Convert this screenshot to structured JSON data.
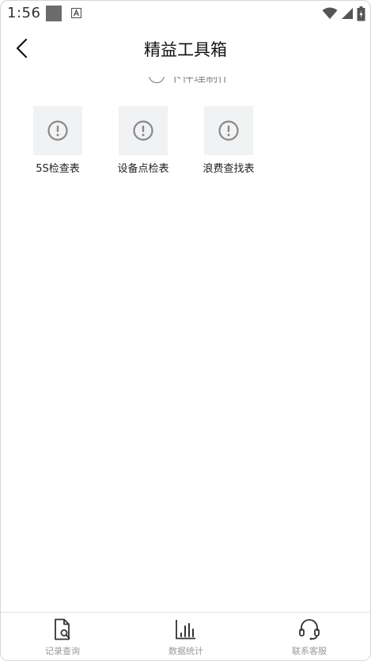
{
  "status_bar": {
    "time": "1:56",
    "icons": [
      "notification-square-icon",
      "a-icon",
      "wifi-icon",
      "signal-icon",
      "battery-icon"
    ]
  },
  "header": {
    "back_icon": "chevron-left-icon",
    "title": "精益工具箱"
  },
  "subtab_remnant": {
    "text": "卜件理制作",
    "icon": "circle-icon"
  },
  "tools": [
    {
      "label": "5S检查表",
      "icon": "alert-circle-icon"
    },
    {
      "label": "设备点检表",
      "icon": "alert-circle-icon"
    },
    {
      "label": "浪费查找表",
      "icon": "alert-circle-icon"
    }
  ],
  "tab_bar": {
    "items": [
      {
        "label": "记录查询",
        "icon": "document-search-icon"
      },
      {
        "label": "数据统计",
        "icon": "bar-chart-icon"
      },
      {
        "label": "联系客服",
        "icon": "headset-icon"
      }
    ]
  },
  "colors": {
    "placeholder_bg": "#f1f2f4",
    "icon_gray": "#888888",
    "tab_label": "#999999"
  }
}
